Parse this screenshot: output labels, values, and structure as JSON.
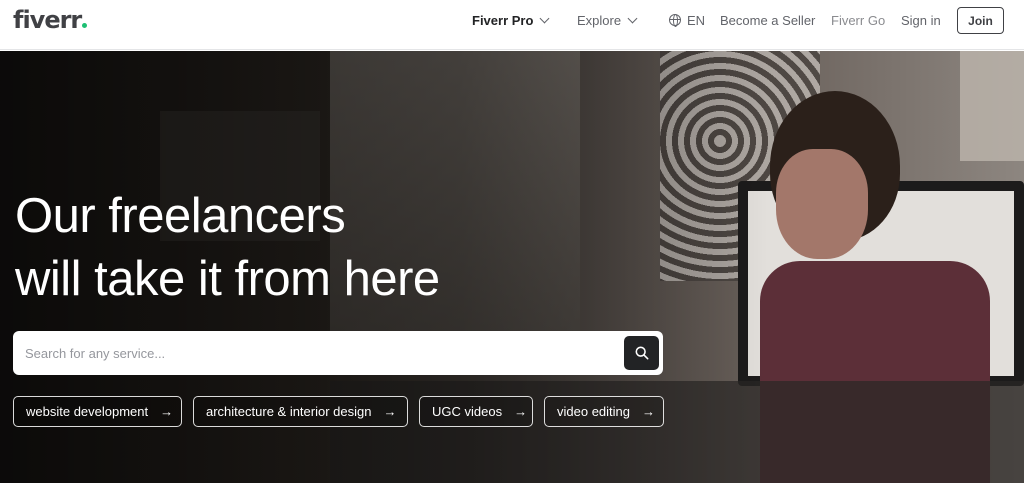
{
  "header": {
    "logo": "fiverr",
    "nav": {
      "pro": "Fiverr Pro",
      "explore": "Explore",
      "language": "EN",
      "become_seller": "Become a Seller",
      "fiverr_go": "Fiverr Go",
      "sign_in": "Sign in",
      "join": "Join"
    }
  },
  "hero": {
    "headline_line1": "Our freelancers",
    "headline_line2": "will take it from here",
    "search": {
      "placeholder": "Search for any service...",
      "value": ""
    },
    "tags": [
      {
        "label": "website development"
      },
      {
        "label": "architecture & interior design"
      },
      {
        "label": "UGC videos"
      },
      {
        "label": "video editing"
      }
    ]
  },
  "icons": {
    "globe": "globe-icon",
    "search": "search-icon",
    "arrow": "arrow-right-icon",
    "chevron": "chevron-down-icon"
  },
  "colors": {
    "brand_green": "#1dbf73",
    "text_dark": "#404145",
    "button_dark": "#222325"
  }
}
